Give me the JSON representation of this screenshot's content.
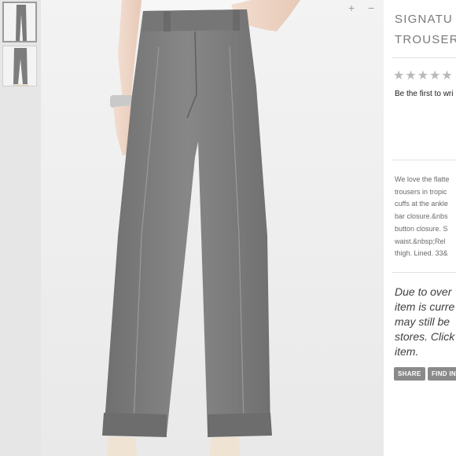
{
  "product": {
    "title_lines": [
      "SIGNATU",
      "TROUSERS"
    ],
    "rating_stars": "★★★★★",
    "review_prompt": "Be the first to wri",
    "description_lines": [
      "We love the flatte",
      "trousers in tropic",
      "cuffs at the ankle",
      "bar closure.&nbs",
      "button closure. S",
      "waist.&nbsp;Rel",
      "thigh. Lined. 33&"
    ],
    "notice_lines": [
      "Due to over",
      "item is curre",
      "may still be",
      "stores. Click",
      "item."
    ],
    "buttons": {
      "share": "SHARE",
      "find": "FIND IN"
    }
  },
  "viewer": {
    "zoom_in": "+",
    "zoom_out": "−"
  },
  "colors": {
    "fabric": "#7f7f7f",
    "panel_bg": "#ffffff",
    "button_bg": "#8a8a8a"
  },
  "icons": [
    "zoom-in-icon",
    "zoom-out-icon",
    "star-icon"
  ]
}
